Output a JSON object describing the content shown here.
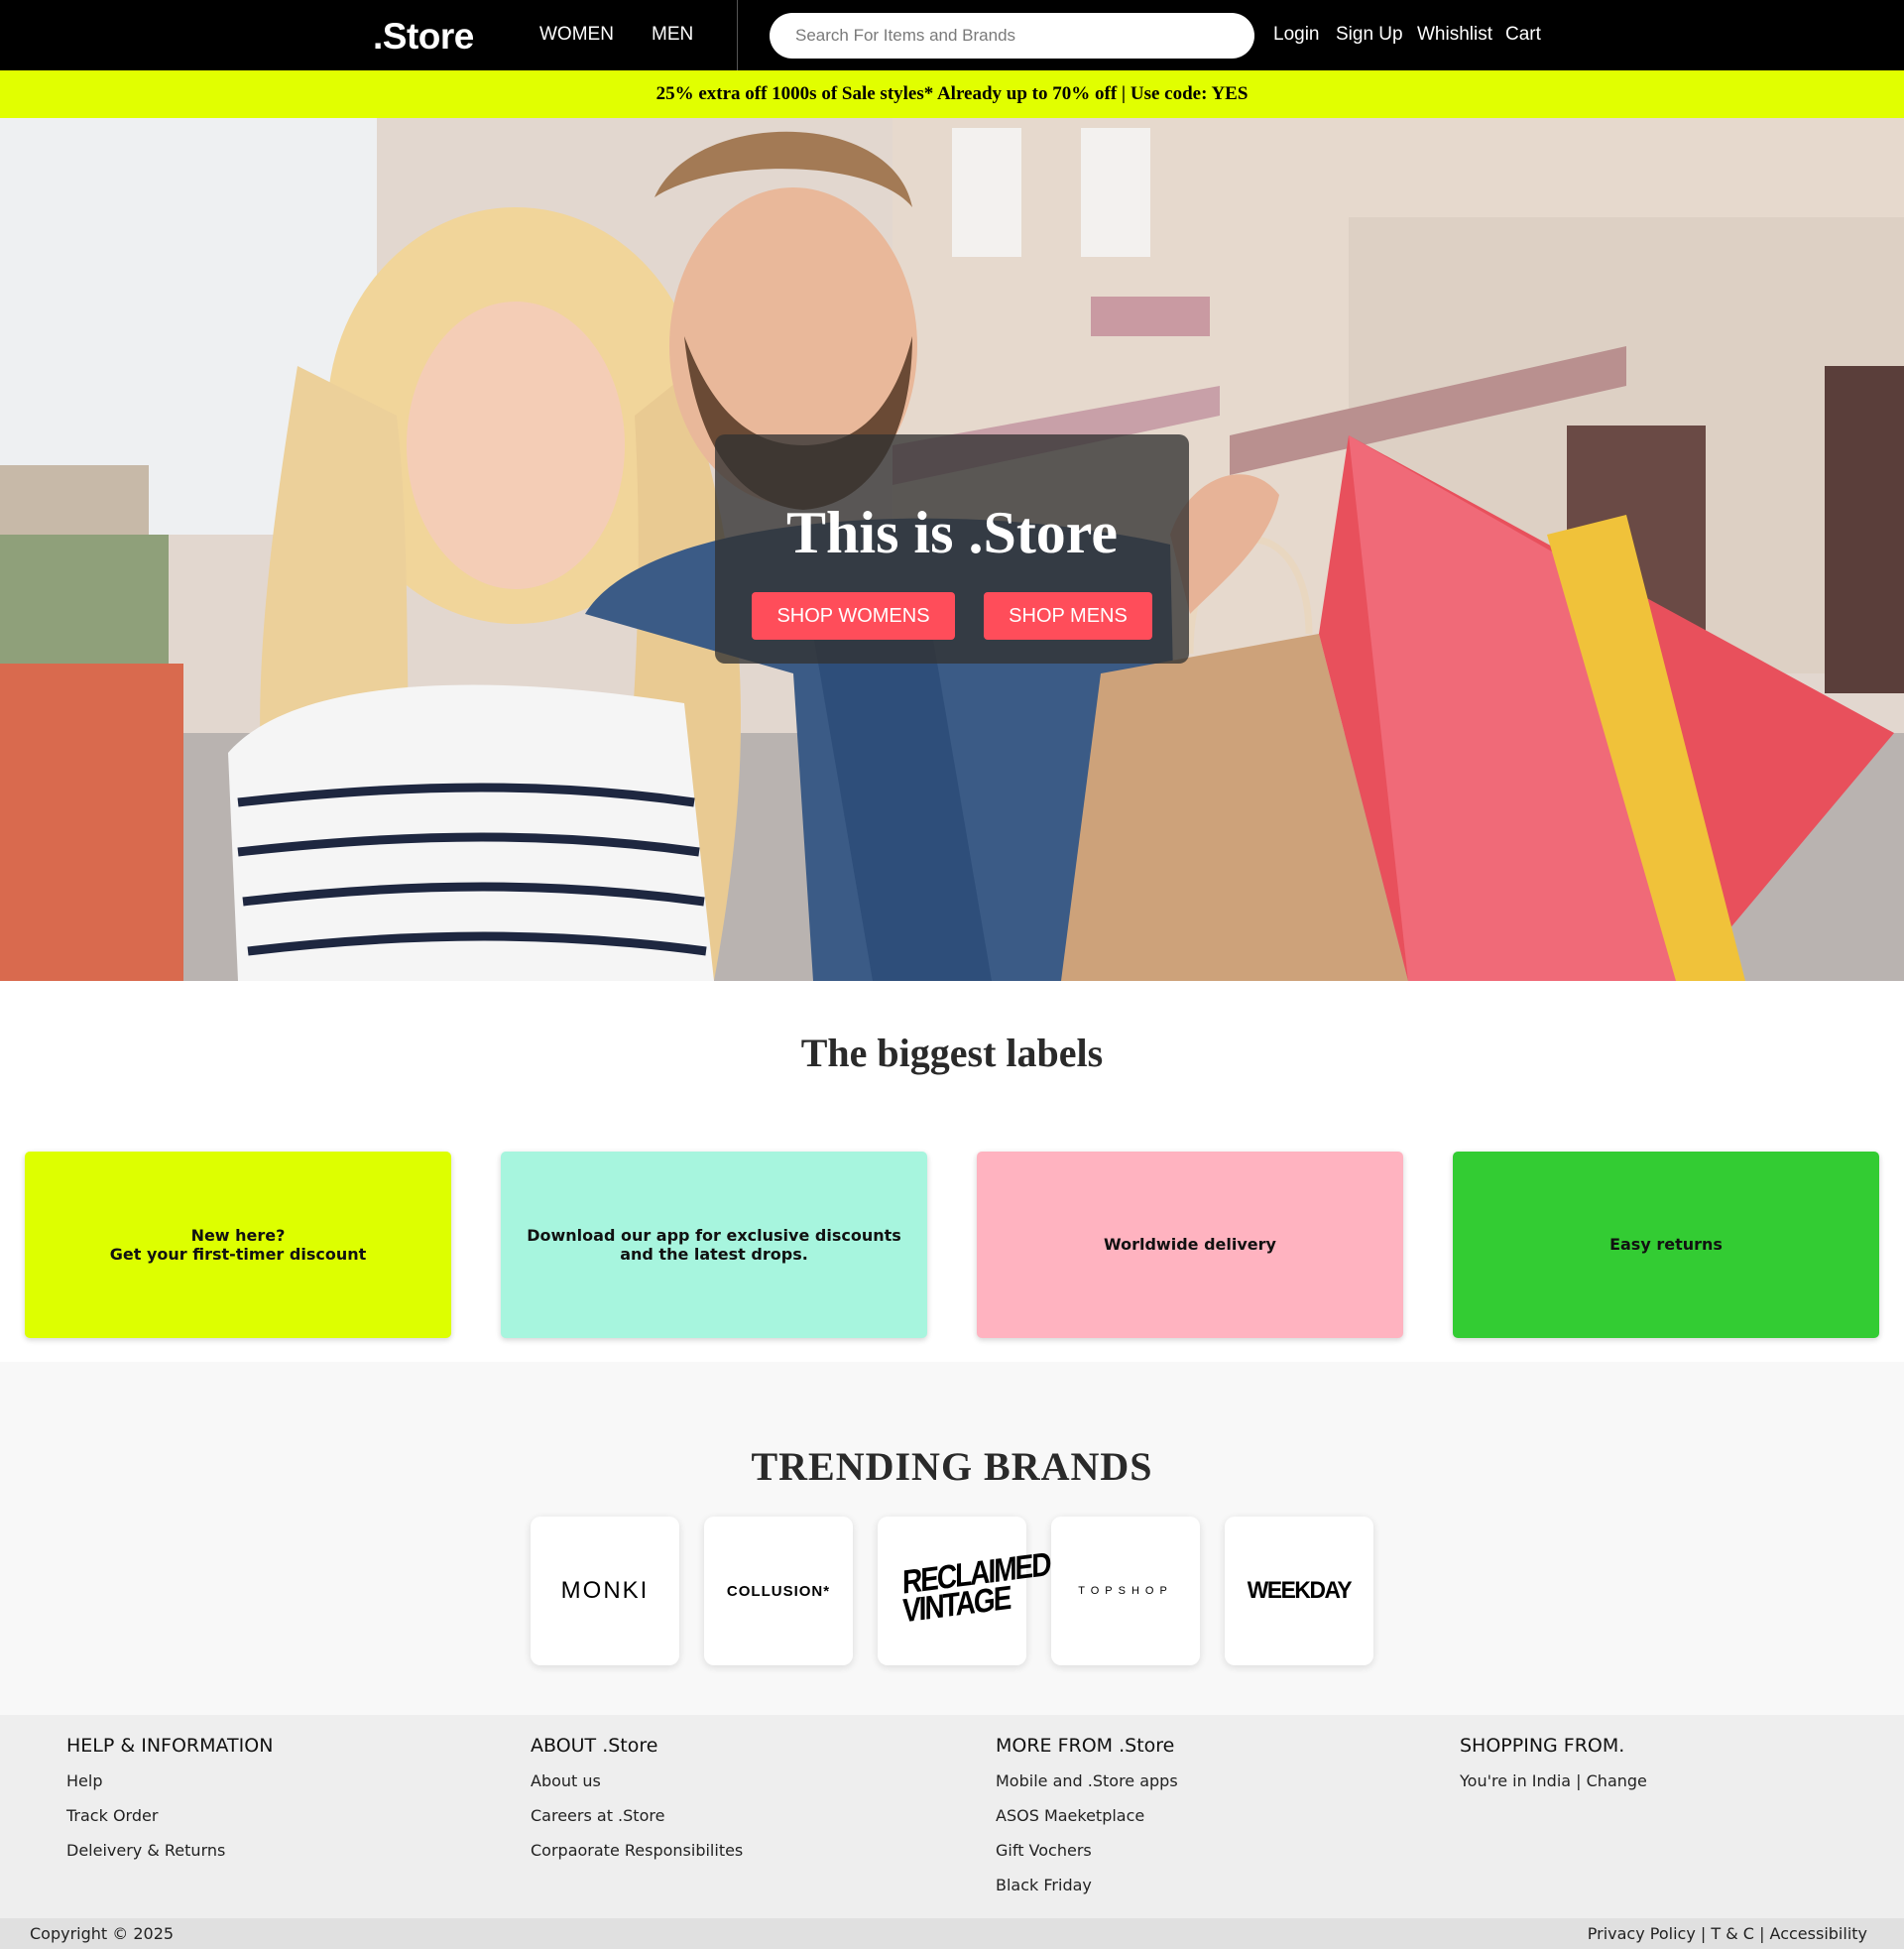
{
  "header": {
    "logo": ".Store",
    "nav": {
      "women": "WOMEN",
      "men": "MEN"
    },
    "search_placeholder": "Search For Items and Brands",
    "user_links": {
      "login": "Login",
      "signup": "Sign Up",
      "wishlist": "Whishlist",
      "cart": "Cart"
    }
  },
  "promo": {
    "text": "25% extra off 1000s of Sale styles* Already up to 70% off | Use code: YES"
  },
  "hero": {
    "title": "This is .Store",
    "shop_womens": "SHOP WOMENS",
    "shop_mens": "SHOP MENS"
  },
  "labels": {
    "title": "The biggest labels",
    "cards": [
      {
        "text": "New here?\nGet your first-timer discount",
        "color": "#ddff00"
      },
      {
        "text": "Download our app for exclusive discounts and the latest drops.",
        "color": "#a7f5de"
      },
      {
        "text": "Worldwide delivery",
        "color": "#ffb3c0"
      },
      {
        "text": "Easy returns",
        "color": "#33cc33"
      }
    ]
  },
  "trending": {
    "title": "TRENDING BRANDS",
    "brands": [
      "MONKI",
      "COLLUSION*",
      "RECLAIMED VINTAGE",
      "TOPSHOP",
      "WEEKDAY"
    ]
  },
  "footer": {
    "columns": [
      {
        "heading": "HELP & INFORMATION",
        "links": [
          "Help",
          "Track Order",
          "Deleivery & Returns"
        ]
      },
      {
        "heading": "ABOUT .Store",
        "links": [
          "About us",
          "Careers at .Store",
          "Corpaorate Responsibilites"
        ]
      },
      {
        "heading": "MORE FROM .Store",
        "links": [
          "Mobile and .Store apps",
          "ASOS Maeketplace",
          "Gift Vochers",
          "Black Friday"
        ]
      },
      {
        "heading": "SHOPPING FROM.",
        "links": [
          "You're in India | Change"
        ]
      }
    ],
    "copyright": "Copyright © 2025",
    "legal": {
      "privacy": "Privacy Policy",
      "sep1": "|",
      "terms": "T & C",
      "sep2": "|",
      "accessibility": "Accessibility"
    }
  },
  "colors": {
    "header_bg": "#000000",
    "promo_bg": "#e1ff00",
    "accent_button": "#ff4d5a"
  }
}
